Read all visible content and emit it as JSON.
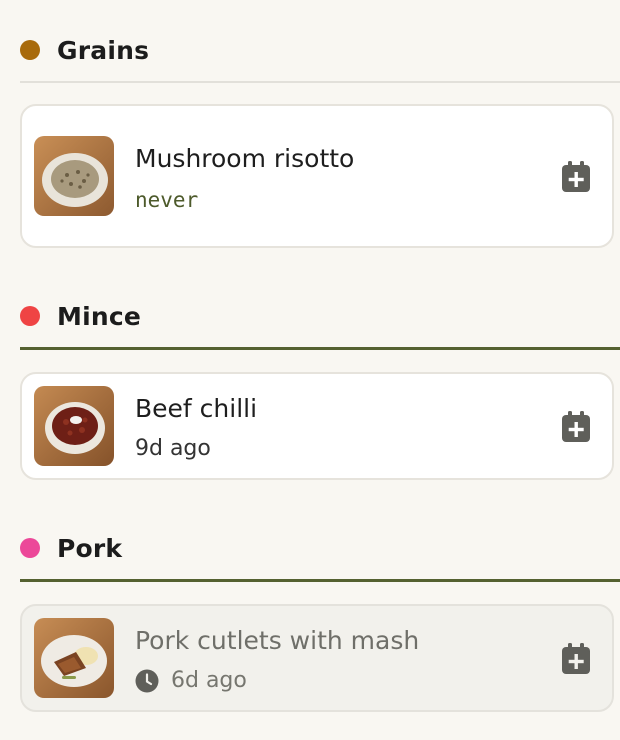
{
  "sections": [
    {
      "title": "Grains",
      "dot_color": "#a86a0b",
      "divider_color": "#e2e0da",
      "recipes": [
        {
          "name": "Mushroom risotto",
          "last_cooked": "never",
          "thumb_icon": "risotto-plate",
          "state": "normal"
        }
      ]
    },
    {
      "title": "Mince",
      "dot_color": "#ef4444",
      "divider_color": "#556131",
      "recipes": [
        {
          "name": "Beef chilli",
          "last_cooked": "9d ago",
          "thumb_icon": "chilli-bowl",
          "state": "normal"
        }
      ]
    },
    {
      "title": "Pork",
      "dot_color": "#ec4899",
      "divider_color": "#556131",
      "recipes": [
        {
          "name": "Pork cutlets with mash",
          "last_cooked": "6d ago",
          "thumb_icon": "pork-plate",
          "state": "recent"
        }
      ]
    }
  ],
  "icons": {
    "add_to_calendar": "calendar-plus-icon",
    "recent": "clock-icon"
  },
  "colors": {
    "accent_olive": "#556131",
    "icon_gray": "#5f5f5a",
    "background": "#f9f7f2"
  }
}
